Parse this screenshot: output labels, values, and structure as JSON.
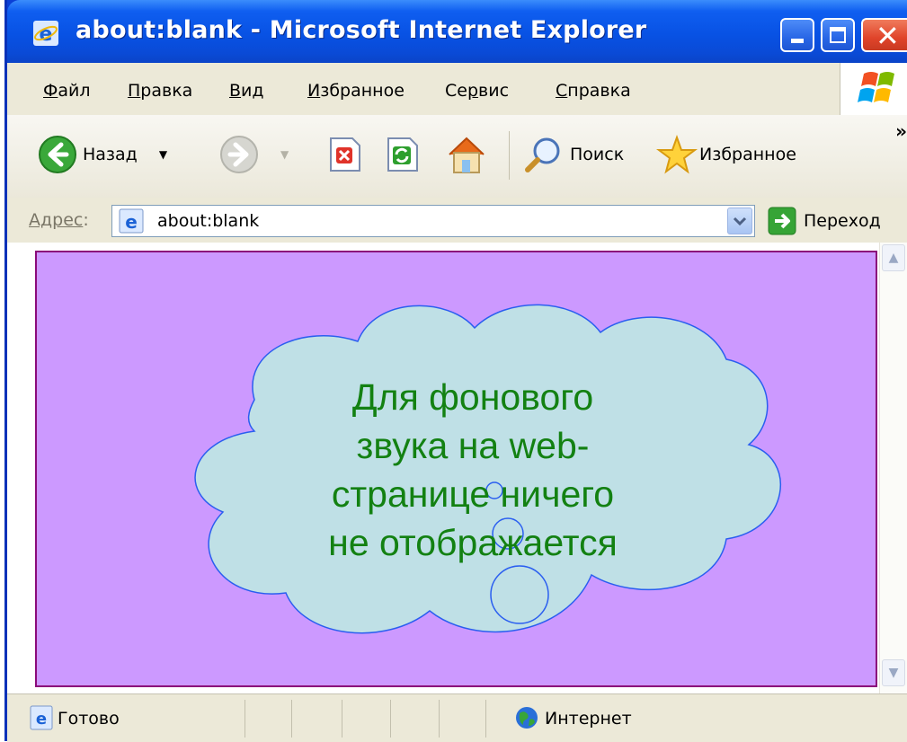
{
  "window": {
    "title": "about:blank - Microsoft Internet Explorer"
  },
  "menu": {
    "items": [
      {
        "first": "Ф",
        "rest": "айл"
      },
      {
        "first": "П",
        "rest": "равка"
      },
      {
        "first": "В",
        "rest": "ид"
      },
      {
        "first": "И",
        "rest": "збранное"
      },
      {
        "pre": "Се",
        "first": "р",
        "rest": "вис"
      },
      {
        "first": "С",
        "rest": "правка"
      }
    ]
  },
  "toolbar": {
    "back_label": "Назад",
    "search_label": "Поиск",
    "favorites_label": "Избранное",
    "overflow": "»"
  },
  "address": {
    "label_main": "Адрес",
    "label_suffix": ":",
    "url": "about:blank",
    "go_label": "Переход"
  },
  "page": {
    "background": "#cc99ff",
    "callout_lines": [
      "Для фонового",
      "звука на web-",
      "странице ничего",
      "не отображается"
    ]
  },
  "status": {
    "text": "Готово",
    "zone": "Интернет"
  }
}
